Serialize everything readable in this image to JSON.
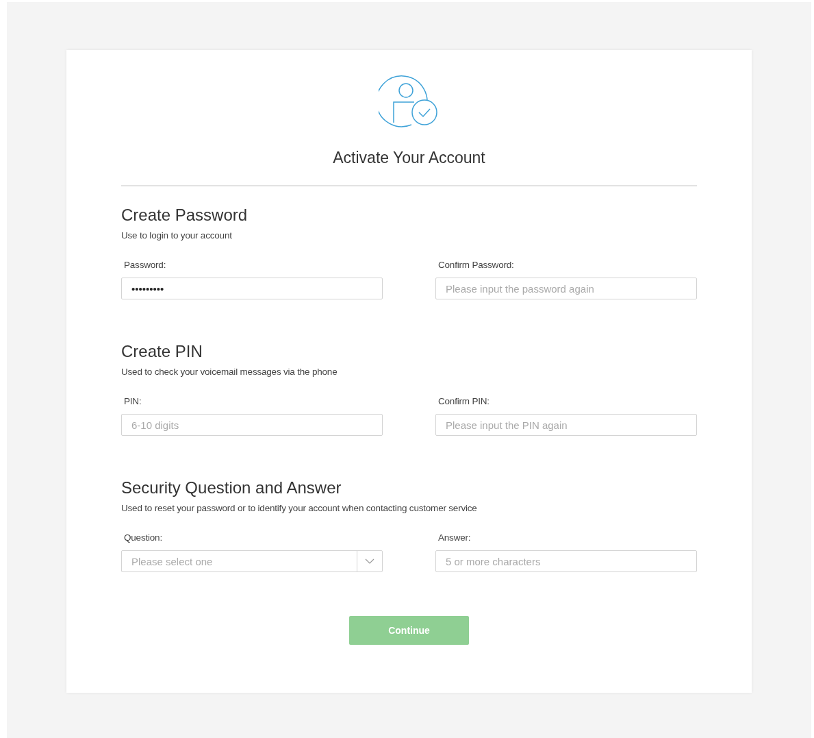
{
  "title": "Activate Your Account",
  "sections": [
    {
      "heading": "Create Password",
      "description": "Use to login to your account",
      "fields": [
        {
          "kind": "text",
          "label": "Password:",
          "value": "•••••••••"
        },
        {
          "kind": "text",
          "label": "Confirm Password:",
          "placeholder": "Please input the password again"
        }
      ]
    },
    {
      "heading": "Create PIN",
      "description": "Used to check your voicemail messages via the phone",
      "fields": [
        {
          "kind": "text",
          "label": "PIN:",
          "placeholder": "6-10 digits"
        },
        {
          "kind": "text",
          "label": "Confirm PIN:",
          "placeholder": "Please input the PIN again"
        }
      ]
    },
    {
      "heading": "Security Question and Answer",
      "description": "Used to reset your password or to identify your account when contacting customer service",
      "fields": [
        {
          "kind": "select",
          "label": "Question:",
          "placeholder": "Please select one"
        },
        {
          "kind": "text",
          "label": "Answer:",
          "placeholder": "5 or more characters"
        }
      ]
    }
  ],
  "button": {
    "label": "Continue",
    "disabled": true
  }
}
